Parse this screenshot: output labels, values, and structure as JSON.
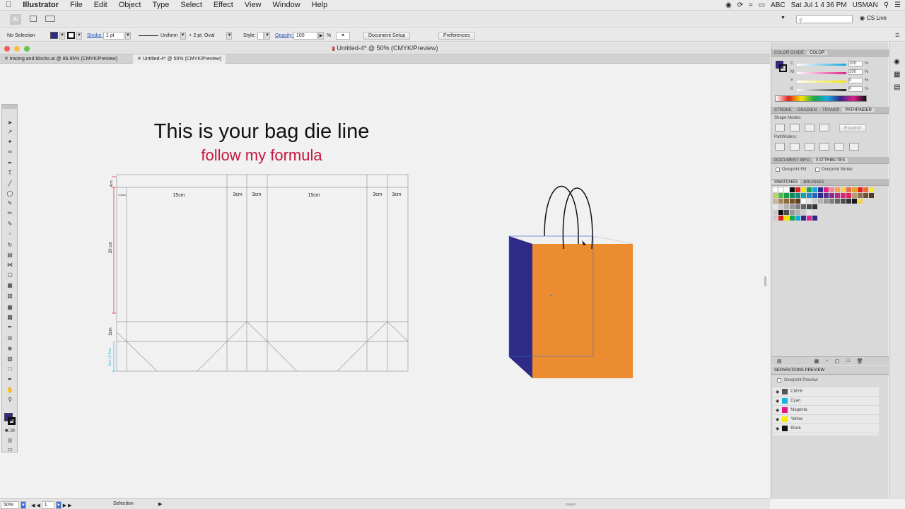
{
  "menubar": {
    "app_name": "Illustrator",
    "items": [
      "File",
      "Edit",
      "Object",
      "Type",
      "Select",
      "Effect",
      "View",
      "Window",
      "Help"
    ],
    "abc": "ABC",
    "clock": "Sat Jul 1  4 36 PM",
    "user": "USMAN"
  },
  "appbar": {
    "workspace": "CS Live"
  },
  "controlbar": {
    "selection": "No Selection",
    "stroke_label": "Stroke:",
    "stroke_weight": "1 pt",
    "profile": "Uniform",
    "brush": "2 pt. Oval",
    "style_label": "Style:",
    "opacity_label": "Opacity:",
    "opacity_value": "100",
    "percent": "%",
    "document_setup": "Document Setup",
    "preferences": "Preferences"
  },
  "window": {
    "title": "Untitled-4* @ 50% (CMYK/Preview)",
    "tabs": [
      {
        "label": "tracing and blocks.ai @ 86.95% (CMYK/Preview)"
      },
      {
        "label": "Untitled-4* @ 50% (CMYK/Preview)"
      }
    ]
  },
  "artwork": {
    "heading": "This is your bag die line",
    "subheading": "follow my formula",
    "dims": {
      "top_flap": "4cm",
      "small": "1.5cm",
      "front": "15cm",
      "side_a": "3cm",
      "side_b": "3cm",
      "back": "15cm",
      "side_c": "3cm",
      "side_d": "3cm",
      "height": "20 cm",
      "bottom": "3cm",
      "bottom_fold": "3cm+1.5cm"
    }
  },
  "panels": {
    "color_tabs": [
      "COLOR GUIDE",
      "COLOR"
    ],
    "cmyk": [
      {
        "channel": "C",
        "value": "100",
        "color": "#18a9e0"
      },
      {
        "channel": "M",
        "value": "100",
        "color": "#e0208c"
      },
      {
        "channel": "Y",
        "value": "0",
        "color": "#f4e600"
      },
      {
        "channel": "K",
        "value": "0",
        "color": "#222222"
      }
    ],
    "pct": "%",
    "pathfinder_tabs": [
      "STROKE",
      "GRADIEN",
      "TRANSP",
      "PATHFINDER"
    ],
    "shape_modes": "Shape Modes:",
    "expand": "Expand",
    "pathfinders": "Pathfinders:",
    "doc_tabs": [
      "DOCUMENT INFO",
      "0 ATTRIBUTES"
    ],
    "overprint_fill": "Overprint Fill",
    "overprint_stroke": "Overprint Stroke",
    "swatch_tabs": [
      "SWATCHES",
      "BRUSHES"
    ],
    "separations_title": "SEPARATIONS PREVIEW",
    "overprint_preview": "Overprint Preview",
    "separations": [
      {
        "name": "CMYK",
        "color": "#555555"
      },
      {
        "name": "Cyan",
        "color": "#18b4e6"
      },
      {
        "name": "Magenta",
        "color": "#e3168b"
      },
      {
        "name": "Yellow",
        "color": "#f7ea00"
      },
      {
        "name": "Black",
        "color": "#111111"
      }
    ]
  },
  "statusbar": {
    "zoom": "50%",
    "page": "1",
    "tool": "Selection"
  },
  "colors": {
    "bag_front": "#ec8c30",
    "bag_side": "#2e2a86",
    "subheading": "#c4173f",
    "fill_swatch": "#2e2a86"
  }
}
